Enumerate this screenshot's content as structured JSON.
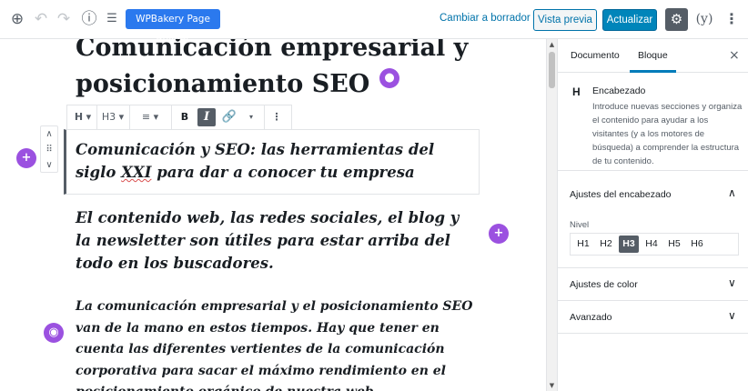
{
  "toolbar": {
    "icons": [
      "add-block-icon",
      "undo-icon",
      "redo-icon",
      "info-icon",
      "outline-icon"
    ],
    "wpbakery_label": "WPBakery Page Builder",
    "draft_label": "Cambiar a borrador",
    "preview_label": "Vista previa",
    "update_label": "Actualizar",
    "accent_color": "#0085ba",
    "wpbakery_color": "#2b79ee"
  },
  "editor": {
    "title_line1": "Comunicación empresarial y",
    "title_line2": "posicionamiento SEO",
    "block_toolbar": {
      "heading_label": "H",
      "level_label": "H3",
      "bold_label": "B",
      "italic_label": "I"
    },
    "h3_pre": "Comunicación y SEO: las herramientas del siglo ",
    "h3_spell": "XXI",
    "h3_post": " para dar a conocer tu empresa",
    "h4_text": "El contenido web, las redes sociales, el blog y la newsletter son útiles para estar arriba del todo en los buscadores.",
    "paragraph_text": "La comunicación empresarial y el posicionamiento SEO van de la mano en estos tiempos. Hay que tener en cuenta las diferentes vertientes de la comunicación corporativa para sacar el máximo rendimiento en el posicionamiento orgánico de nuestra web.",
    "purple_color": "#9b51e0"
  },
  "sidebar": {
    "tab_document": "Documento",
    "tab_block": "Bloque",
    "close_label": "×",
    "block_icon": "H",
    "block_name": "Encabezado",
    "block_description": "Introduce nuevas secciones y organiza el contenido para ayudar a los visitantes (y a los motores de búsqueda) a comprender la estructura de tu contenido.",
    "heading_settings_title": "Ajustes del encabezado",
    "level_label": "Nivel",
    "levels": [
      "H1",
      "H2",
      "H3",
      "H4",
      "H5",
      "H6"
    ],
    "active_level": "H3",
    "color_settings_title": "Ajustes de color",
    "advanced_title": "Avanzado"
  }
}
